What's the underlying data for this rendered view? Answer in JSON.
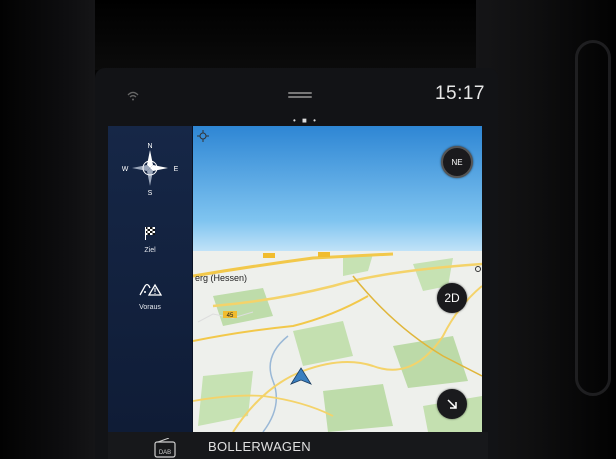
{
  "status_bar": {
    "clock": "15:17"
  },
  "side_panel": {
    "compass": {
      "n": "N",
      "s": "S",
      "e": "E",
      "w": "W"
    },
    "items": [
      {
        "label": "Ziel",
        "icon": "checkered-flag-icon"
      },
      {
        "label": "Voraus",
        "icon": "route-ahead-icon"
      }
    ]
  },
  "map": {
    "compass_badge": "NE",
    "view_mode": "2D",
    "place_label": "erg (Hessen)",
    "road_labels": [
      "45"
    ],
    "colors": {
      "sky": "#3aa0e0",
      "land": "#eef0ec",
      "forest": "#b9dba6",
      "road": "#f3c94a",
      "water": "#8aaed0"
    }
  },
  "bottom_bar": {
    "source_icon": "DAB",
    "track": "BOLLERWAGEN"
  }
}
